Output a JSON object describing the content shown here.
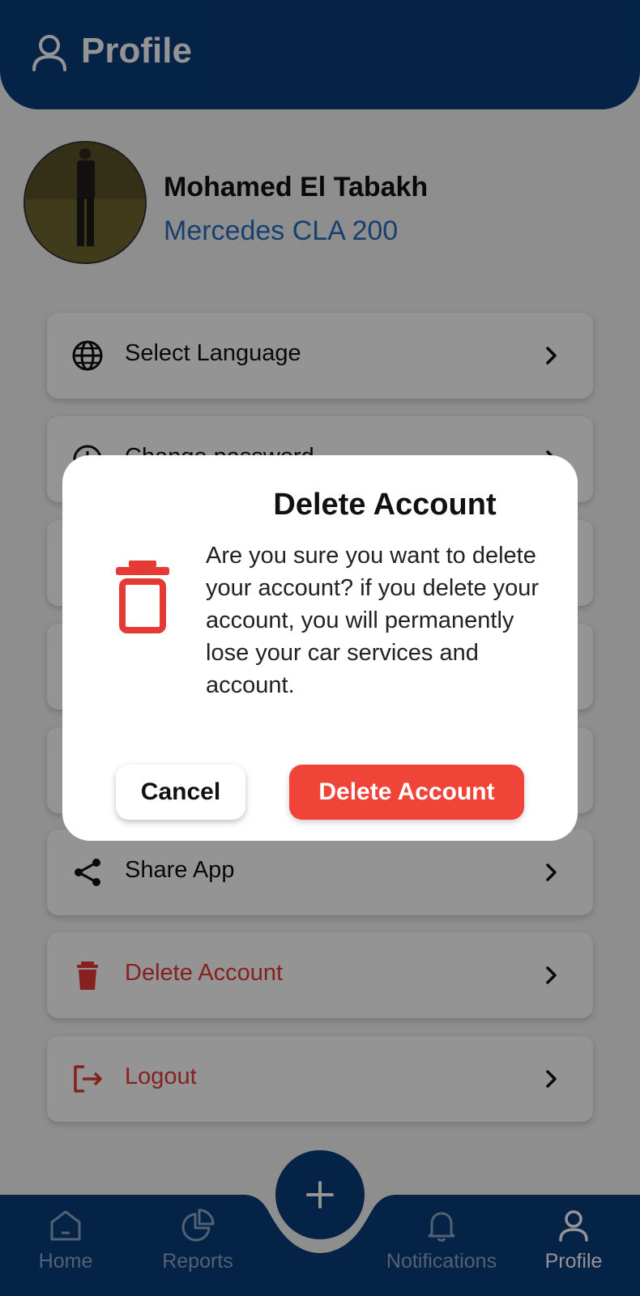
{
  "header": {
    "title": "Profile",
    "icon": "user-icon"
  },
  "profile": {
    "name": "Mohamed El Tabakh",
    "car": "Mercedes CLA 200"
  },
  "menu": [
    {
      "label": "Select Language",
      "icon": "globe-icon"
    },
    {
      "label": "Change password",
      "icon": "password-icon"
    },
    {
      "label": "",
      "icon": ""
    },
    {
      "label": "",
      "icon": ""
    },
    {
      "label": "",
      "icon": ""
    },
    {
      "label": "Share App",
      "icon": "share-icon"
    },
    {
      "label": "Delete Account",
      "icon": "trash-icon"
    },
    {
      "label": "Logout",
      "icon": "logout-icon"
    }
  ],
  "bottom_nav": [
    {
      "label": "Home",
      "icon": "home-icon"
    },
    {
      "label": "Reports",
      "icon": "pie-chart-icon"
    },
    {
      "label": "Notifications",
      "icon": "bell-icon"
    },
    {
      "label": "Profile",
      "icon": "user-icon",
      "active": true
    }
  ],
  "dialog": {
    "title": "Delete Account",
    "message": "Are you sure you want to delete your account? if you delete your account, you will permanently lose your car services and account.",
    "cancel_label": "Cancel",
    "confirm_label": "Delete Account"
  },
  "colors": {
    "primary": "#0a3b7a",
    "danger": "#e53935",
    "accent_text": "#2a6ebf"
  }
}
